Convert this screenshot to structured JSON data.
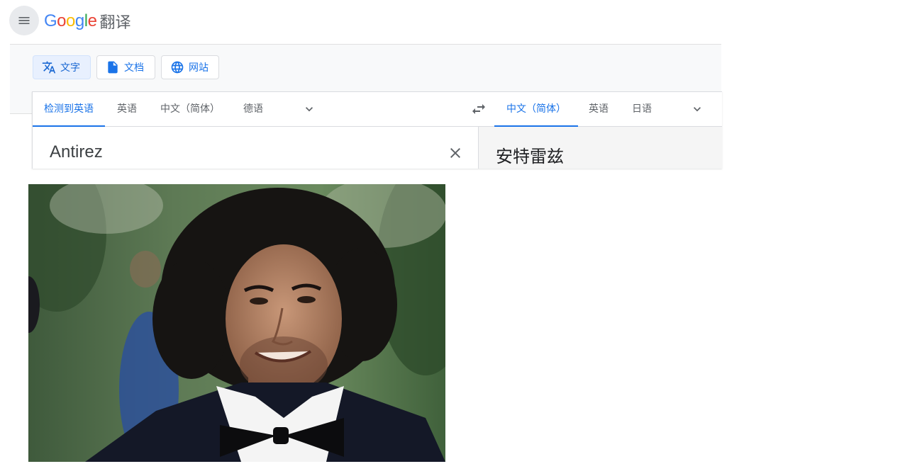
{
  "header": {
    "logo_g1": "G",
    "logo_o1": "o",
    "logo_o2": "o",
    "logo_g2": "g",
    "logo_l": "l",
    "logo_e": "e",
    "product_name": "翻译"
  },
  "modes": [
    {
      "label": "文字",
      "icon": "translate-icon",
      "active": true
    },
    {
      "label": "文档",
      "icon": "document-icon",
      "active": false
    },
    {
      "label": "网站",
      "icon": "globe-icon",
      "active": false
    }
  ],
  "source_languages": [
    "检测到英语",
    "英语",
    "中文（简体）",
    "德语"
  ],
  "target_languages": [
    "中文（简体）",
    "英语",
    "日语"
  ],
  "source_text": "Antirez",
  "translated_text": "安特雷兹",
  "colors": {
    "accent": "#1a73e8",
    "active_mode_bg": "#e8f0fe",
    "toolbar_bg": "#f8f9fa",
    "target_pane_bg": "#f5f5f5"
  }
}
